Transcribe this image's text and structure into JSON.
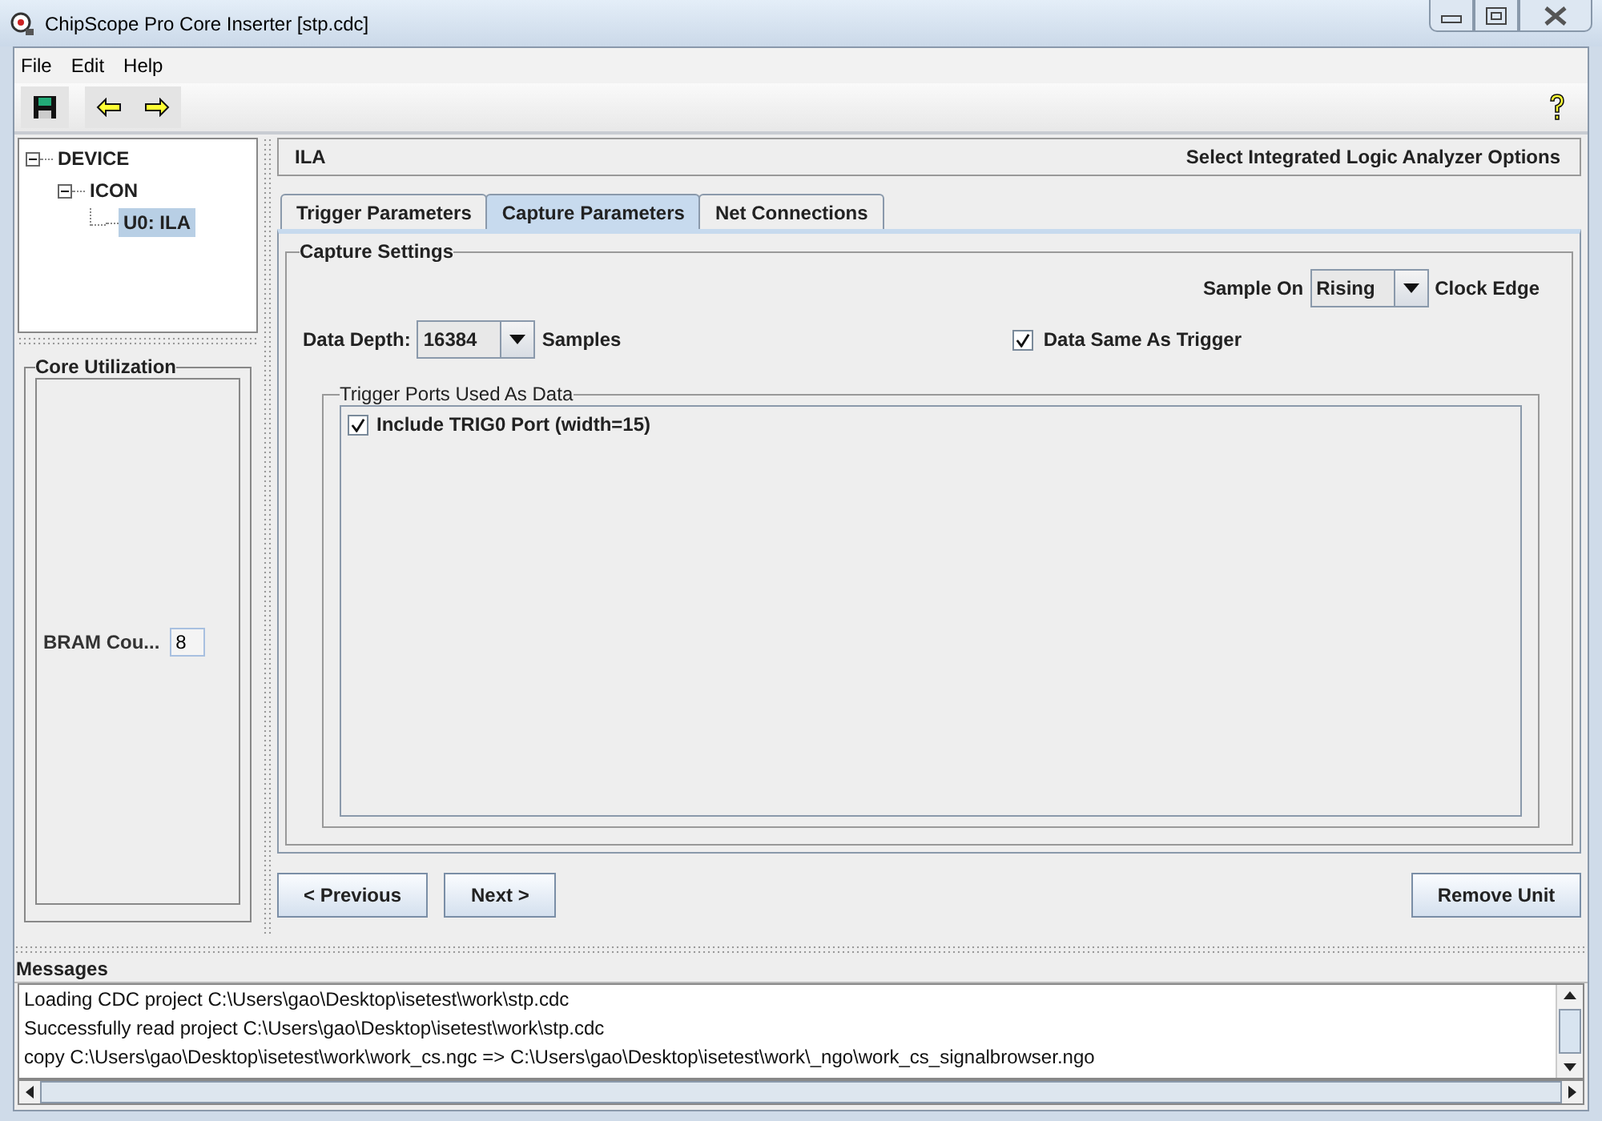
{
  "window": {
    "title": "ChipScope Pro Core Inserter [stp.cdc]"
  },
  "menu": [
    {
      "label": "File"
    },
    {
      "label": "Edit"
    },
    {
      "label": "Help"
    }
  ],
  "tree": [
    {
      "label": "DEVICE",
      "expanded": true,
      "selected": false,
      "children": [
        {
          "label": "ICON",
          "expanded": true,
          "selected": false,
          "children": [
            {
              "label": "U0: ILA",
              "selected": true
            }
          ]
        }
      ]
    }
  ],
  "core_utilization": {
    "title": "Core Utilization",
    "label": "BRAM Cou...",
    "value": "8"
  },
  "header": {
    "title": "ILA",
    "subtitle": "Select Integrated Logic Analyzer Options"
  },
  "tabs": [
    {
      "label": "Trigger Parameters",
      "selected": false
    },
    {
      "label": "Capture Parameters",
      "selected": true
    },
    {
      "label": "Net Connections",
      "selected": false
    }
  ],
  "capture_settings": {
    "title": "Capture Settings",
    "sample_on": {
      "label": "Sample On",
      "value": "Rising",
      "suffix": "Clock Edge"
    },
    "data_depth": {
      "label": "Data Depth:",
      "value": "16384",
      "suffix": "Samples"
    },
    "data_same_as_trigger": {
      "label": "Data Same As Trigger",
      "checked": true
    },
    "trigger_ports": {
      "title": "Trigger Ports Used As Data",
      "items": [
        {
          "label": "Include TRIG0 Port (width=15)",
          "checked": true
        }
      ]
    }
  },
  "buttons": [
    {
      "label": "< Previous"
    },
    {
      "label": "Next >"
    },
    {
      "label": "Remove Unit"
    }
  ],
  "messages": {
    "title": "Messages",
    "lines": [
      "Loading CDC project C:\\Users\\gao\\Desktop\\isetest\\work\\stp.cdc",
      "Successfully read project C:\\Users\\gao\\Desktop\\isetest\\work\\stp.cdc",
      "copy C:\\Users\\gao\\Desktop\\isetest\\work\\work_cs.ngc => C:\\Users\\gao\\Desktop\\isetest\\work\\_ngo\\work_cs_signalbrowser.ngo"
    ]
  }
}
